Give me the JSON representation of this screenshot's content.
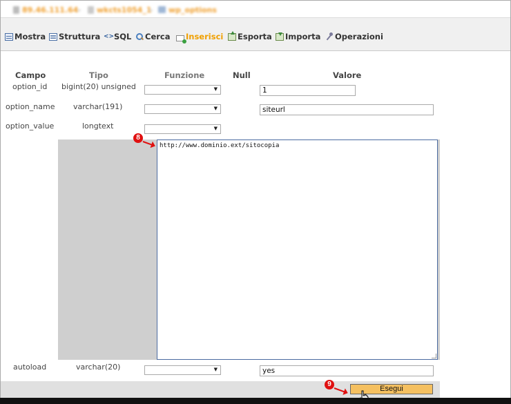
{
  "breadcrumb": {
    "server": "89.46.111.64",
    "database": "wkcts1054_1",
    "table": "wp_options"
  },
  "tabs": [
    {
      "label": "Mostra",
      "icon": "browse-icon"
    },
    {
      "label": "Struttura",
      "icon": "structure-icon"
    },
    {
      "label": "SQL",
      "icon": "sql-icon"
    },
    {
      "label": "Cerca",
      "icon": "search-icon"
    },
    {
      "label": "Inserisci",
      "icon": "insert-icon",
      "active": true
    },
    {
      "label": "Esporta",
      "icon": "export-icon"
    },
    {
      "label": "Importa",
      "icon": "import-icon"
    },
    {
      "label": "Operazioni",
      "icon": "operations-icon"
    }
  ],
  "headers": {
    "campo": "Campo",
    "tipo": "Tipo",
    "funzione": "Funzione",
    "null": "Null",
    "valore": "Valore"
  },
  "rows": [
    {
      "campo": "option_id",
      "tipo": "bigint(20) unsigned",
      "valore": "1"
    },
    {
      "campo": "option_name",
      "tipo": "varchar(191)",
      "valore": "siteurl"
    },
    {
      "campo": "option_value",
      "tipo": "longtext",
      "valore": "http://www.dominio.ext/sitocopia"
    },
    {
      "campo": "autoload",
      "tipo": "varchar(20)",
      "valore": "yes"
    }
  ],
  "annotations": {
    "step8": "8",
    "step9": "9"
  },
  "footer": {
    "go_label": "Esegui"
  },
  "colors": {
    "accent": "#f0a000",
    "annotation": "#e01010",
    "go_button": "#f5c060"
  }
}
